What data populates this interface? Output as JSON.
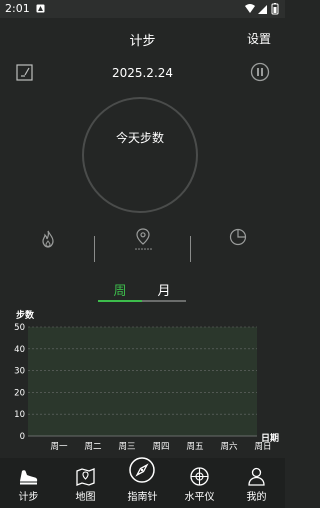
{
  "status_bar": {
    "time": "2:01"
  },
  "header": {
    "title": "计步",
    "settings_label": "设置"
  },
  "date_row": {
    "date": "2025.2.24"
  },
  "step_circle": {
    "label": "今天步数"
  },
  "period_tabs": {
    "week_label": "周",
    "month_label": "月",
    "selected": "week"
  },
  "chart_data": {
    "type": "bar",
    "ylabel": "步数",
    "xlabel": "日期",
    "ylim": [
      0,
      50
    ],
    "y_ticks": [
      0,
      10,
      20,
      30,
      40,
      50
    ],
    "categories": [
      "周一",
      "周二",
      "周三",
      "周四",
      "周五",
      "周六",
      "周日"
    ],
    "values": [
      0,
      0,
      0,
      0,
      0,
      0,
      0
    ],
    "grid": "dashed horizontal",
    "colors": {
      "plot_bg": "#2b372c",
      "grid": "#6a6c6b",
      "axis_text": "#ffffff"
    }
  },
  "bottom_nav": {
    "items": [
      {
        "label": "计步",
        "icon": "shoe-icon",
        "active": true
      },
      {
        "label": "地图",
        "icon": "map-icon",
        "active": false
      },
      {
        "label": "指南针",
        "icon": "compass-icon",
        "active": false
      },
      {
        "label": "水平仪",
        "icon": "level-icon",
        "active": false
      },
      {
        "label": "我的",
        "icon": "person-icon",
        "active": false
      }
    ]
  },
  "colors": {
    "accent": "#3dbd4c",
    "background": "#242625",
    "nav_background": "#1e201f"
  }
}
